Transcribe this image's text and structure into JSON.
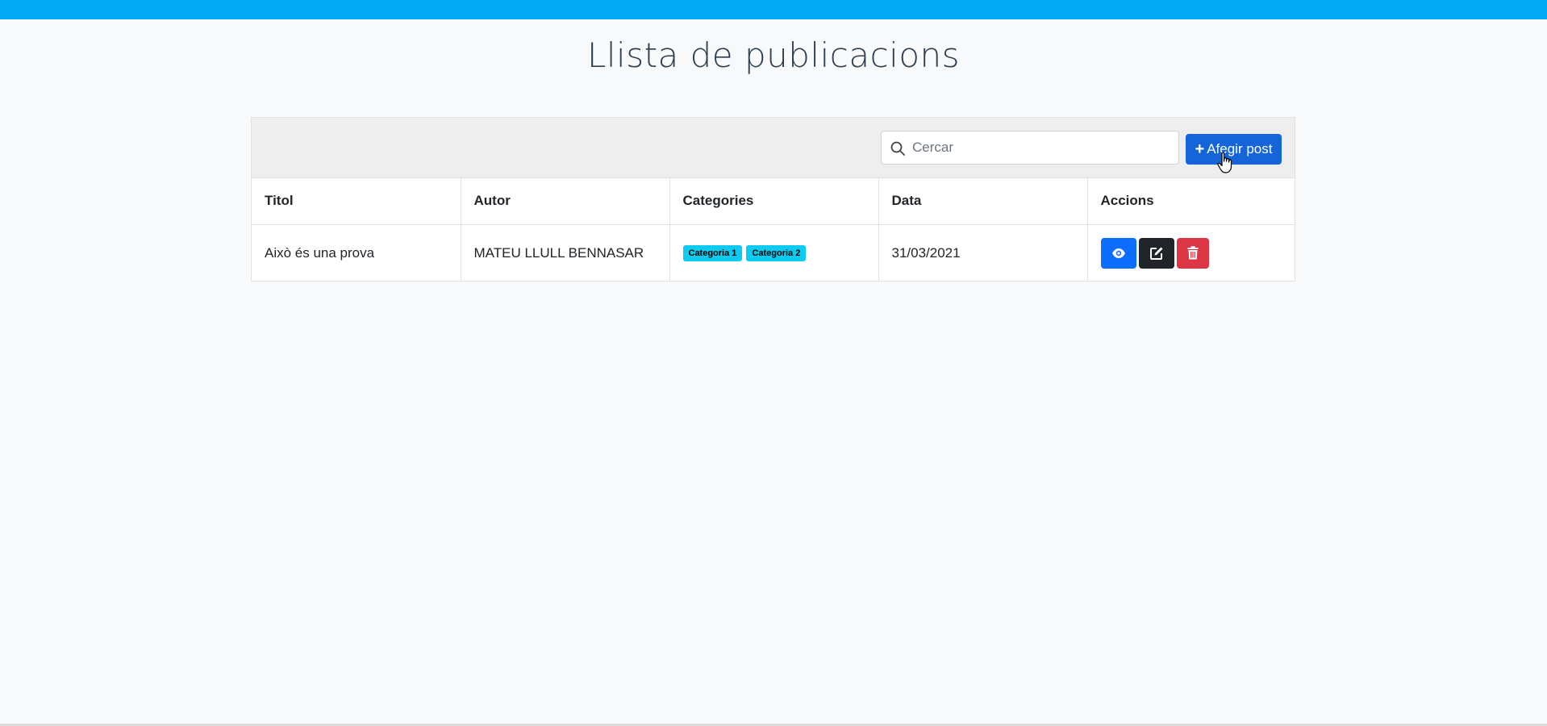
{
  "page": {
    "title": "Llista de publicacions"
  },
  "toolbar": {
    "search_placeholder": "Cercar",
    "add_button_label": "Afegir post",
    "add_button_icon": "plus-icon"
  },
  "table": {
    "headers": [
      "Titol",
      "Autor",
      "Categories",
      "Data",
      "Accions"
    ],
    "rows": [
      {
        "titol": "Això és una prova",
        "autor": "MATEU LLULL BENNASAR",
        "categories": [
          "Categoria 1",
          "Categoria 2"
        ],
        "data": "31/03/2021",
        "actions": [
          "view-icon",
          "edit-icon",
          "trash-icon"
        ]
      }
    ]
  },
  "colors": {
    "topbar": "#03a9f4",
    "primary": "#0d6efd",
    "dark": "#212529",
    "danger": "#dc3545",
    "info_badge": "#0dcaf0"
  }
}
